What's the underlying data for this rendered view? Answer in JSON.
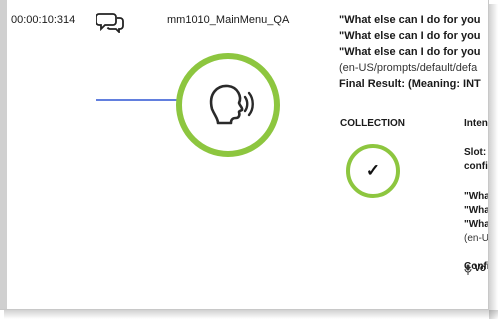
{
  "row": {
    "timestamp": "00:00:10:314",
    "chat_icon": "chat-bubbles-icon",
    "dialog_name": "mm1010_MainMenu_QA"
  },
  "prompt": {
    "lines": [
      "\"What else can I do for you",
      "\"What else can I do for you",
      "\"What else can I do for you"
    ],
    "path": "(en-US/prompts/default/defa",
    "final_result": "Final Result: (Meaning: INT"
  },
  "speak_icon": "speaking-head-icon",
  "collection": {
    "label": "COLLECTION",
    "check_icon": "check-icon",
    "check": "✓"
  },
  "intent_column": {
    "header": "Intent",
    "slot": "Slot:",
    "confi": "confi",
    "what_1": "\"What",
    "what_2": "\"What",
    "what_3": "\"What",
    "path": "(en-U",
    "conf": "Confi",
    "vo": "Vo",
    "mic_icon": "microphone-icon"
  },
  "colors": {
    "accent": "#8dc63f",
    "arrow": "#2f55d4"
  }
}
